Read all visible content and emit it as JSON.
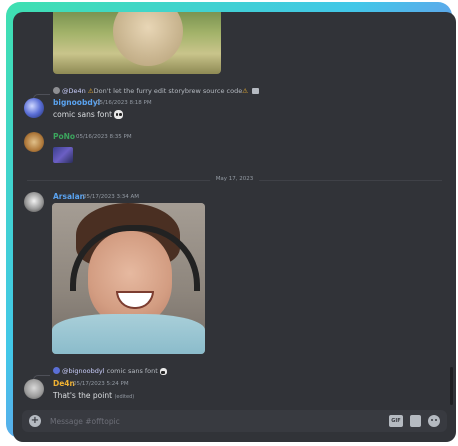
{
  "messages": [
    {
      "reply": {
        "mention": "@De4n",
        "text": "Don't let the furry edit storybrew source code"
      },
      "author": "bignoobdyl",
      "author_color": "#5aa3f0",
      "timestamp": "05/16/2023 8:18 PM",
      "text": "comic sans font"
    },
    {
      "author": "PoNo",
      "author_color": "#3ba55d",
      "timestamp": "05/16/2023 8:35 PM"
    },
    {
      "author": "Arsalan",
      "author_color": "#5aa3f0",
      "timestamp": "05/17/2023 3:34 AM"
    },
    {
      "reply": {
        "mention": "@bignoobdyl",
        "text": "comic sans font"
      },
      "author": "De4n",
      "author_color": "#f0b232",
      "timestamp": "05/17/2023 5:24 PM",
      "text": "That's the point",
      "edited": "(edited)"
    }
  ],
  "date_divider": "May 17, 2023",
  "composer": {
    "placeholder": "Message #offtopic",
    "value": "",
    "gif_label": "GIF"
  },
  "colors": {
    "background": "#313338",
    "composer": "#383a40",
    "text": "#dbdee1",
    "muted": "#949ba4",
    "warning": "#f0b232"
  },
  "icons": {
    "warning": "warning-icon",
    "skull": "skull-icon",
    "add": "plus-circle-icon",
    "gif": "gif-icon",
    "sticker": "sticker-icon",
    "emoji": "emoji-icon"
  }
}
